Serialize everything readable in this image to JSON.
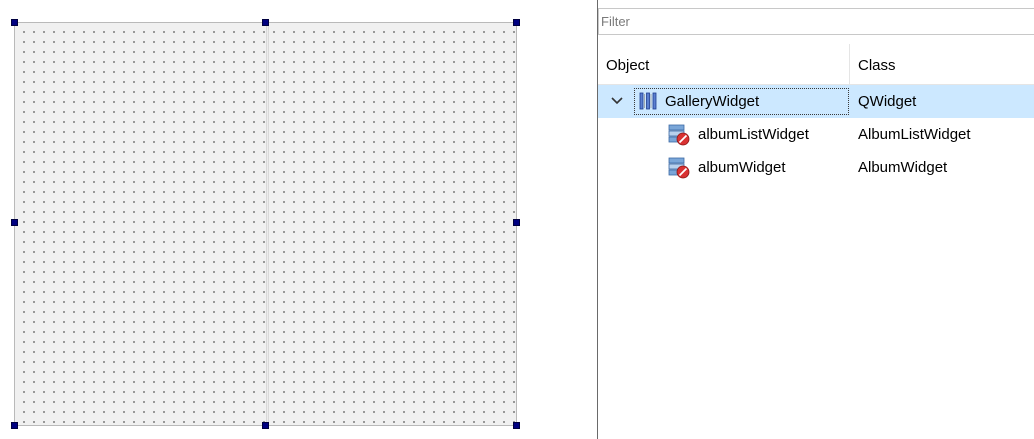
{
  "filter": {
    "placeholder": "Filter",
    "value": ""
  },
  "tree": {
    "headers": {
      "object": "Object",
      "class": "Class"
    },
    "rows": [
      {
        "object": "GalleryWidget",
        "class": "QWidget",
        "icon": "vertical-splitter-icon",
        "selected": true,
        "expanded": true
      },
      {
        "object": "albumListWidget",
        "class": "AlbumListWidget",
        "icon": "custom-widget-icon",
        "selected": false
      },
      {
        "object": "albumWidget",
        "class": "AlbumWidget",
        "icon": "custom-widget-icon",
        "selected": false
      }
    ]
  },
  "colors": {
    "selection": "#cce8ff",
    "handle": "#000080",
    "canvas": "#f0f0f0"
  }
}
